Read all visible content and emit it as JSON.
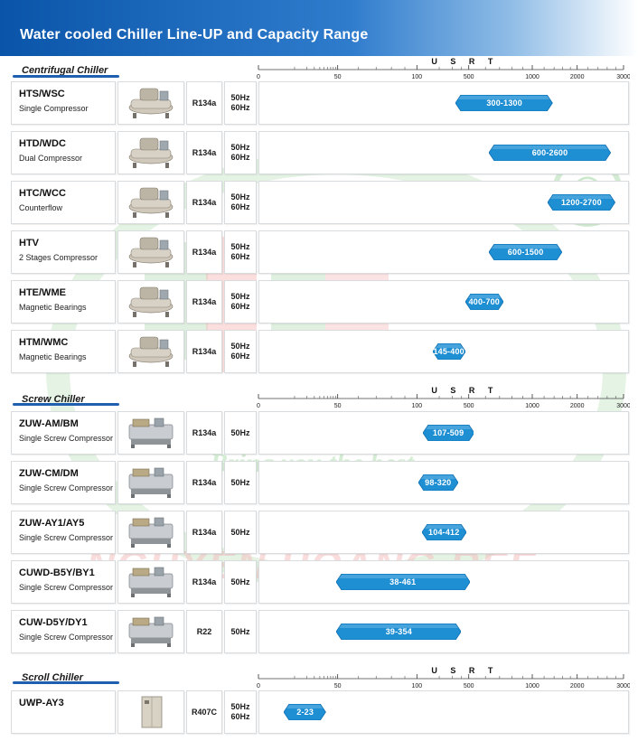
{
  "header": {
    "title": "Water cooled Chiller Line-UP and Capacity Range"
  },
  "watermark": {
    "company": "NGUYEN HOANG REE",
    "slogan": "Bring you the best",
    "registered": "®"
  },
  "colors": {
    "header_start": "#0a55a9",
    "bar": "#1f8fd3",
    "bar_dark": "#0f6fb3",
    "section_line": "#1f5fb0"
  },
  "chart_data": {
    "type": "bar",
    "orientation": "horizontal-range",
    "title": "Water cooled Chiller Line-UP and Capacity Range",
    "xlabel": "U S R T",
    "xscale": "log",
    "xlim": [
      0,
      3000
    ],
    "xticks": [
      0,
      50,
      100,
      500,
      1000,
      2000,
      3000
    ],
    "sections": [
      {
        "name": "Centrifugal Chiller",
        "rows": [
          {
            "model": "HTS/WSC",
            "desc": "Single Compressor",
            "refrigerant": "R134a",
            "hz": [
              "50Hz",
              "60Hz"
            ],
            "icon": "centrifugal-chiller-icon",
            "min": 300,
            "max": 1300,
            "label": "300-1300"
          },
          {
            "model": "HTD/WDC",
            "desc": "Dual Compressor",
            "refrigerant": "R134a",
            "hz": [
              "50Hz",
              "60Hz"
            ],
            "icon": "dual-centrifugal-chiller-icon",
            "min": 600,
            "max": 2600,
            "label": "600-2600"
          },
          {
            "model": "HTC/WCC",
            "desc": "Counterflow",
            "refrigerant": "R134a",
            "hz": [
              "50Hz",
              "60Hz"
            ],
            "icon": "counterflow-chiller-icon",
            "min": 1200,
            "max": 2700,
            "label": "1200-2700"
          },
          {
            "model": "HTV",
            "desc": "2 Stages Compressor",
            "refrigerant": "R134a",
            "hz": [
              "50Hz",
              "60Hz"
            ],
            "icon": "two-stage-chiller-icon",
            "min": 600,
            "max": 1500,
            "label": "600-1500"
          },
          {
            "model": "HTE/WME",
            "desc": "Magnetic Bearings",
            "refrigerant": "R134a",
            "hz": [
              "50Hz",
              "60Hz"
            ],
            "icon": "magnetic-bearing-chiller-icon",
            "min": 400,
            "max": 700,
            "label": "400-700"
          },
          {
            "model": "HTM/WMC",
            "desc": "Magnetic Bearings",
            "refrigerant": "R134a",
            "hz": [
              "50Hz",
              "60Hz"
            ],
            "icon": "magnetic-bearing-chiller-icon",
            "min": 145,
            "max": 400,
            "label": "145-400"
          }
        ]
      },
      {
        "name": "Screw Chiller",
        "rows": [
          {
            "model": "ZUW-AM/BM",
            "desc": "Single Screw Compressor",
            "refrigerant": "R134a",
            "hz": [
              "50Hz"
            ],
            "icon": "screw-chiller-icon",
            "min": 107,
            "max": 509,
            "label": "107-509"
          },
          {
            "model": "ZUW-CM/DM",
            "desc": "Single Screw Compressor",
            "refrigerant": "R134a",
            "hz": [
              "50Hz"
            ],
            "icon": "screw-chiller-icon",
            "min": 98,
            "max": 320,
            "label": "98-320"
          },
          {
            "model": "ZUW-AY1/AY5",
            "desc": "Single Screw Compressor",
            "refrigerant": "R134a",
            "hz": [
              "50Hz"
            ],
            "icon": "screw-chiller-icon",
            "min": 104,
            "max": 412,
            "label": "104-412"
          },
          {
            "model": "CUWD-B5Y/BY1",
            "desc": "Single Screw Compressor",
            "refrigerant": "R134a",
            "hz": [
              "50Hz"
            ],
            "icon": "screw-chiller-icon",
            "min": 38,
            "max": 461,
            "label": "38-461"
          },
          {
            "model": "CUW-D5Y/DY1",
            "desc": "Single Screw Compressor",
            "refrigerant": "R22",
            "hz": [
              "50Hz"
            ],
            "icon": "screw-chiller-icon",
            "min": 39,
            "max": 354,
            "label": "39-354"
          }
        ]
      },
      {
        "name": "Scroll Chiller",
        "rows": [
          {
            "model": "UWP-AY3",
            "desc": "",
            "refrigerant": "R407C",
            "hz": [
              "50Hz",
              "60Hz"
            ],
            "icon": "scroll-chiller-cabinet-icon",
            "min": 2,
            "max": 23,
            "label": "2-23"
          }
        ]
      }
    ]
  }
}
